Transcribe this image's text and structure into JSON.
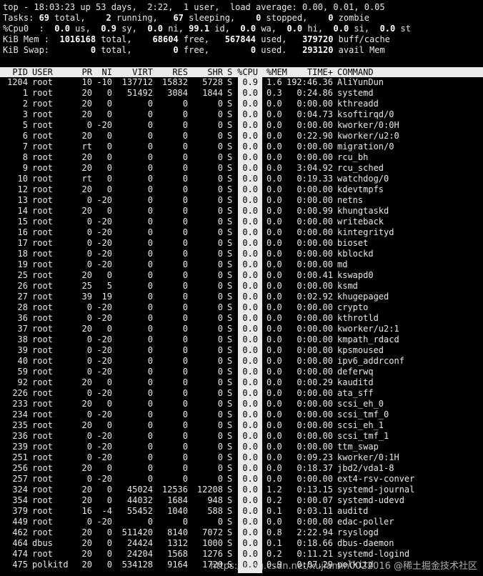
{
  "summary": {
    "line1": "top - 18:03:23 up 53 days,  2:22,  1 user,  load average: 0.00, 0.01, 0.05",
    "line2": [
      [
        "Tasks: ",
        0
      ],
      [
        "69",
        1
      ],
      [
        " total,    ",
        0
      ],
      [
        "2",
        1
      ],
      [
        " running,   ",
        0
      ],
      [
        "67",
        1
      ],
      [
        " sleeping,    ",
        0
      ],
      [
        "0",
        1
      ],
      [
        " stopped,    ",
        0
      ],
      [
        "0",
        1
      ],
      [
        " zombie",
        0
      ]
    ],
    "line3": [
      [
        "%Cpu0  : ",
        0
      ],
      [
        " 0.0",
        1
      ],
      [
        " us,  ",
        0
      ],
      [
        "0.9",
        1
      ],
      [
        " sy,  ",
        0
      ],
      [
        "0.0",
        1
      ],
      [
        " ni, ",
        0
      ],
      [
        "99.1",
        1
      ],
      [
        " id,  ",
        0
      ],
      [
        "0.0",
        1
      ],
      [
        " wa,  ",
        0
      ],
      [
        "0.0",
        1
      ],
      [
        " hi,  ",
        0
      ],
      [
        "0.0",
        1
      ],
      [
        " si,  ",
        0
      ],
      [
        "0.0",
        1
      ],
      [
        " st",
        0
      ]
    ],
    "line4": [
      [
        "KiB Mem : ",
        0
      ],
      [
        " 1016168",
        1
      ],
      [
        " total,    ",
        0
      ],
      [
        "68604",
        1
      ],
      [
        " free,   ",
        0
      ],
      [
        "567844",
        1
      ],
      [
        " used,   ",
        0
      ],
      [
        "379720",
        1
      ],
      [
        " buff/cache",
        0
      ]
    ],
    "line5": [
      [
        "KiB Swap: ",
        0
      ],
      [
        "       0",
        1
      ],
      [
        " total,        ",
        0
      ],
      [
        "0",
        1
      ],
      [
        " free,        ",
        0
      ],
      [
        "0",
        1
      ],
      [
        " used.   ",
        0
      ],
      [
        "293120",
        1
      ],
      [
        " avail Mem",
        0
      ]
    ]
  },
  "columns": [
    "PID",
    "USER",
    "PR",
    "NI",
    "VIRT",
    "RES",
    "SHR",
    "S",
    "%CPU",
    "%MEM",
    "TIME+",
    "COMMAND"
  ],
  "processes": [
    [
      "1204",
      "root",
      "10",
      "-10",
      "137712",
      "15832",
      "5728",
      "S",
      "0.9",
      "1.6",
      "192:46.36",
      "AliYunDun"
    ],
    [
      "1",
      "root",
      "20",
      "0",
      "51492",
      "3084",
      "1844",
      "S",
      "0.0",
      "0.3",
      "0:24.86",
      "systemd"
    ],
    [
      "2",
      "root",
      "20",
      "0",
      "0",
      "0",
      "0",
      "S",
      "0.0",
      "0.0",
      "0:00.00",
      "kthreadd"
    ],
    [
      "3",
      "root",
      "20",
      "0",
      "0",
      "0",
      "0",
      "S",
      "0.0",
      "0.0",
      "0:04.73",
      "ksoftirqd/0"
    ],
    [
      "5",
      "root",
      "0",
      "-20",
      "0",
      "0",
      "0",
      "S",
      "0.0",
      "0.0",
      "0:00.00",
      "kworker/0:0H"
    ],
    [
      "6",
      "root",
      "20",
      "0",
      "0",
      "0",
      "0",
      "S",
      "0.0",
      "0.0",
      "0:22.90",
      "kworker/u2:0"
    ],
    [
      "7",
      "root",
      "rt",
      "0",
      "0",
      "0",
      "0",
      "S",
      "0.0",
      "0.0",
      "0:00.00",
      "migration/0"
    ],
    [
      "8",
      "root",
      "20",
      "0",
      "0",
      "0",
      "0",
      "S",
      "0.0",
      "0.0",
      "0:00.00",
      "rcu_bh"
    ],
    [
      "9",
      "root",
      "20",
      "0",
      "0",
      "0",
      "0",
      "S",
      "0.0",
      "0.0",
      "3:04.92",
      "rcu_sched"
    ],
    [
      "10",
      "root",
      "rt",
      "0",
      "0",
      "0",
      "0",
      "S",
      "0.0",
      "0.0",
      "0:19.33",
      "watchdog/0"
    ],
    [
      "12",
      "root",
      "20",
      "0",
      "0",
      "0",
      "0",
      "S",
      "0.0",
      "0.0",
      "0:00.00",
      "kdevtmpfs"
    ],
    [
      "13",
      "root",
      "0",
      "-20",
      "0",
      "0",
      "0",
      "S",
      "0.0",
      "0.0",
      "0:00.00",
      "netns"
    ],
    [
      "14",
      "root",
      "20",
      "0",
      "0",
      "0",
      "0",
      "S",
      "0.0",
      "0.0",
      "0:00.99",
      "khungtaskd"
    ],
    [
      "15",
      "root",
      "0",
      "-20",
      "0",
      "0",
      "0",
      "S",
      "0.0",
      "0.0",
      "0:00.00",
      "writeback"
    ],
    [
      "16",
      "root",
      "0",
      "-20",
      "0",
      "0",
      "0",
      "S",
      "0.0",
      "0.0",
      "0:00.00",
      "kintegrityd"
    ],
    [
      "17",
      "root",
      "0",
      "-20",
      "0",
      "0",
      "0",
      "S",
      "0.0",
      "0.0",
      "0:00.00",
      "bioset"
    ],
    [
      "18",
      "root",
      "0",
      "-20",
      "0",
      "0",
      "0",
      "S",
      "0.0",
      "0.0",
      "0:00.00",
      "kblockd"
    ],
    [
      "19",
      "root",
      "0",
      "-20",
      "0",
      "0",
      "0",
      "S",
      "0.0",
      "0.0",
      "0:00.00",
      "md"
    ],
    [
      "25",
      "root",
      "20",
      "0",
      "0",
      "0",
      "0",
      "S",
      "0.0",
      "0.0",
      "0:00.41",
      "kswapd0"
    ],
    [
      "26",
      "root",
      "25",
      "5",
      "0",
      "0",
      "0",
      "S",
      "0.0",
      "0.0",
      "0:00.00",
      "ksmd"
    ],
    [
      "27",
      "root",
      "39",
      "19",
      "0",
      "0",
      "0",
      "S",
      "0.0",
      "0.0",
      "0:02.92",
      "khugepaged"
    ],
    [
      "28",
      "root",
      "0",
      "-20",
      "0",
      "0",
      "0",
      "S",
      "0.0",
      "0.0",
      "0:00.00",
      "crypto"
    ],
    [
      "36",
      "root",
      "0",
      "-20",
      "0",
      "0",
      "0",
      "S",
      "0.0",
      "0.0",
      "0:00.00",
      "kthrotld"
    ],
    [
      "37",
      "root",
      "20",
      "0",
      "0",
      "0",
      "0",
      "S",
      "0.0",
      "0.0",
      "0:00.00",
      "kworker/u2:1"
    ],
    [
      "38",
      "root",
      "0",
      "-20",
      "0",
      "0",
      "0",
      "S",
      "0.0",
      "0.0",
      "0:00.00",
      "kmpath_rdacd"
    ],
    [
      "39",
      "root",
      "0",
      "-20",
      "0",
      "0",
      "0",
      "S",
      "0.0",
      "0.0",
      "0:00.00",
      "kpsmoused"
    ],
    [
      "40",
      "root",
      "0",
      "-20",
      "0",
      "0",
      "0",
      "S",
      "0.0",
      "0.0",
      "0:00.00",
      "ipv6_addrconf"
    ],
    [
      "59",
      "root",
      "0",
      "-20",
      "0",
      "0",
      "0",
      "S",
      "0.0",
      "0.0",
      "0:00.00",
      "deferwq"
    ],
    [
      "92",
      "root",
      "20",
      "0",
      "0",
      "0",
      "0",
      "S",
      "0.0",
      "0.0",
      "0:00.29",
      "kauditd"
    ],
    [
      "226",
      "root",
      "0",
      "-20",
      "0",
      "0",
      "0",
      "S",
      "0.0",
      "0.0",
      "0:00.00",
      "ata_sff"
    ],
    [
      "233",
      "root",
      "20",
      "0",
      "0",
      "0",
      "0",
      "S",
      "0.0",
      "0.0",
      "0:00.00",
      "scsi_eh_0"
    ],
    [
      "234",
      "root",
      "0",
      "-20",
      "0",
      "0",
      "0",
      "S",
      "0.0",
      "0.0",
      "0:00.00",
      "scsi_tmf_0"
    ],
    [
      "235",
      "root",
      "20",
      "0",
      "0",
      "0",
      "0",
      "S",
      "0.0",
      "0.0",
      "0:00.00",
      "scsi_eh_1"
    ],
    [
      "236",
      "root",
      "0",
      "-20",
      "0",
      "0",
      "0",
      "S",
      "0.0",
      "0.0",
      "0:00.00",
      "scsi_tmf_1"
    ],
    [
      "239",
      "root",
      "0",
      "-20",
      "0",
      "0",
      "0",
      "S",
      "0.0",
      "0.0",
      "0:00.00",
      "ttm_swap"
    ],
    [
      "251",
      "root",
      "0",
      "-20",
      "0",
      "0",
      "0",
      "S",
      "0.0",
      "0.0",
      "0:09.23",
      "kworker/0:1H"
    ],
    [
      "256",
      "root",
      "20",
      "0",
      "0",
      "0",
      "0",
      "S",
      "0.0",
      "0.0",
      "0:18.37",
      "jbd2/vda1-8"
    ],
    [
      "257",
      "root",
      "0",
      "-20",
      "0",
      "0",
      "0",
      "S",
      "0.0",
      "0.0",
      "0:00.00",
      "ext4-rsv-conver"
    ],
    [
      "324",
      "root",
      "20",
      "0",
      "45024",
      "12536",
      "12208",
      "S",
      "0.0",
      "1.2",
      "0:13.15",
      "systemd-journal"
    ],
    [
      "354",
      "root",
      "20",
      "0",
      "44032",
      "1684",
      "948",
      "S",
      "0.0",
      "0.2",
      "0:00.07",
      "systemd-udevd"
    ],
    [
      "379",
      "root",
      "16",
      "-4",
      "55452",
      "1040",
      "588",
      "S",
      "0.0",
      "0.1",
      "0:03.11",
      "auditd"
    ],
    [
      "449",
      "root",
      "0",
      "-20",
      "0",
      "0",
      "0",
      "S",
      "0.0",
      "0.0",
      "0:00.00",
      "edac-poller"
    ],
    [
      "462",
      "root",
      "20",
      "0",
      "511420",
      "8140",
      "7072",
      "S",
      "0.0",
      "0.8",
      "2:22.94",
      "rsyslogd"
    ],
    [
      "464",
      "dbus",
      "20",
      "0",
      "24424",
      "1312",
      "1000",
      "S",
      "0.0",
      "0.1",
      "0:18.66",
      "dbus-daemon"
    ],
    [
      "474",
      "root",
      "20",
      "0",
      "24204",
      "1568",
      "1276",
      "S",
      "0.0",
      "0.2",
      "0:11.21",
      "systemd-logind"
    ],
    [
      "475",
      "polkitd",
      "20",
      "0",
      "534128",
      "9164",
      "1720",
      "S",
      "0.0",
      "0.9",
      "0:07.29",
      "polkitd"
    ]
  ],
  "watermark": "https://blog.csdn.net/xujiamin0022016  @稀土掘金技术社区"
}
